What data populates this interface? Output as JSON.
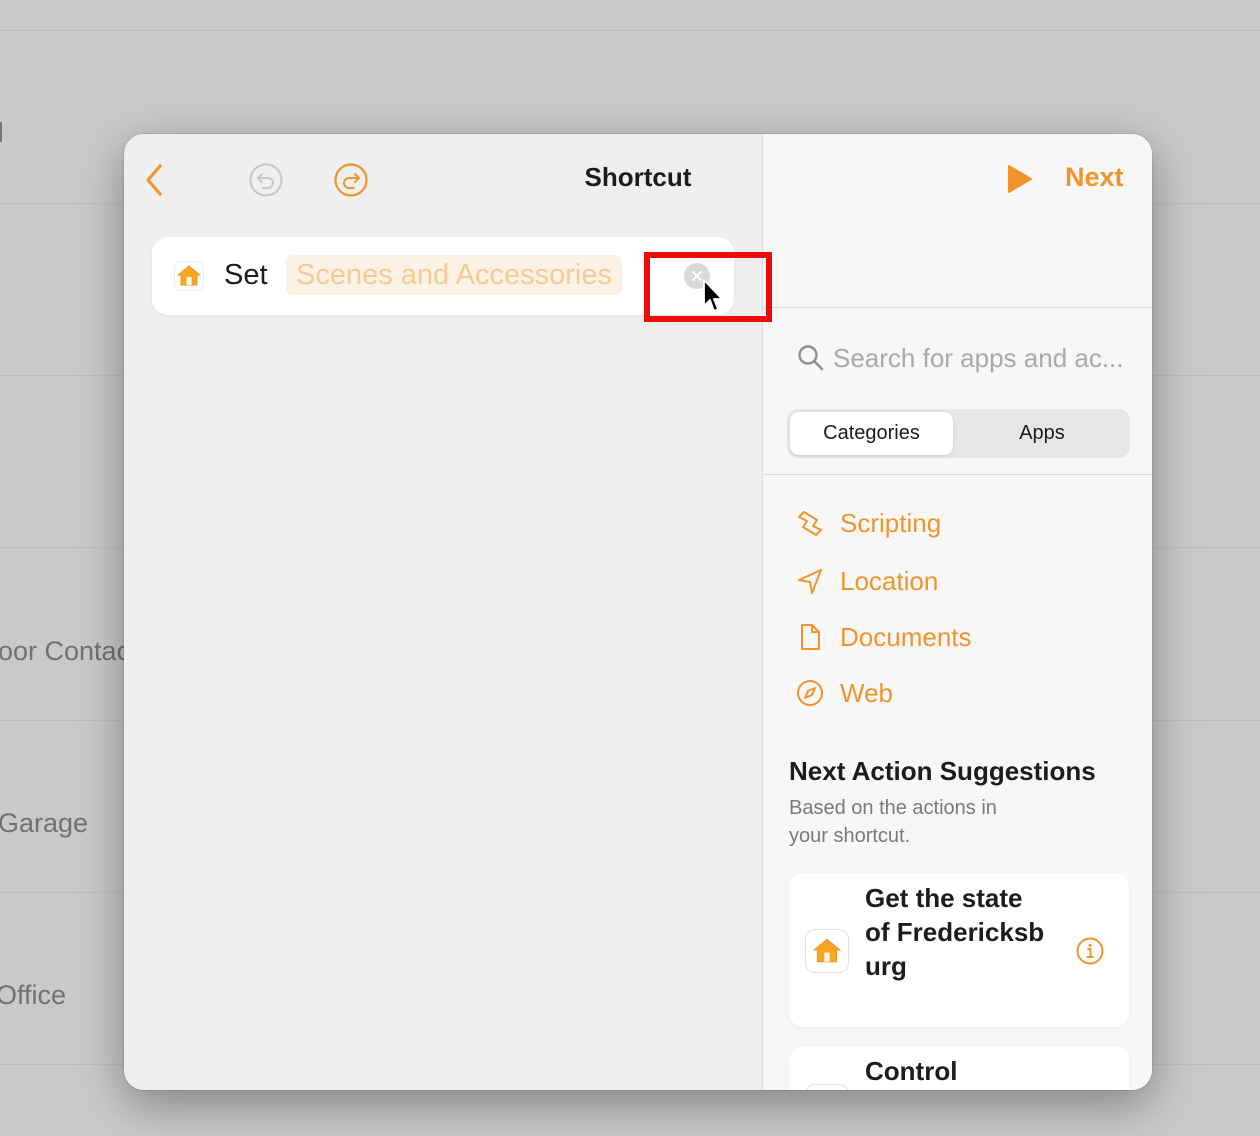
{
  "background": {
    "items": [
      {
        "label": "oor Contac"
      },
      {
        "label": "Garage"
      },
      {
        "label": "Office"
      }
    ]
  },
  "toolbar": {
    "back_icon": "chevron-left-icon",
    "undo_icon": "undo-icon",
    "redo_icon": "redo-icon",
    "title": "Shortcut"
  },
  "action": {
    "app_icon": "home-icon",
    "verb": "Set",
    "parameter_placeholder": "Scenes and Accessories",
    "clear_icon": "clear-icon"
  },
  "header_right": {
    "run_icon": "play-icon",
    "next_label": "Next"
  },
  "search": {
    "placeholder": "Search for apps and ac..."
  },
  "segments": {
    "categories": "Categories",
    "apps": "Apps",
    "selected": "Categories"
  },
  "categories": [
    {
      "label": "Scripting",
      "icon": "scripting-icon"
    },
    {
      "label": "Location",
      "icon": "location-arrow-icon"
    },
    {
      "label": "Documents",
      "icon": "document-icon"
    },
    {
      "label": "Web",
      "icon": "compass-icon"
    }
  ],
  "suggestions": {
    "title": "Next Action Suggestions",
    "subtitle": "Based on the actions in your shortcut.",
    "items": [
      {
        "text": "Get the state of Fredericksburg",
        "icon": "home-icon",
        "info_icon": "info-icon"
      },
      {
        "text": "Control",
        "icon": "home-icon"
      }
    ]
  },
  "colors": {
    "accent": "#f0952e",
    "highlight": "#ec0c0c"
  }
}
